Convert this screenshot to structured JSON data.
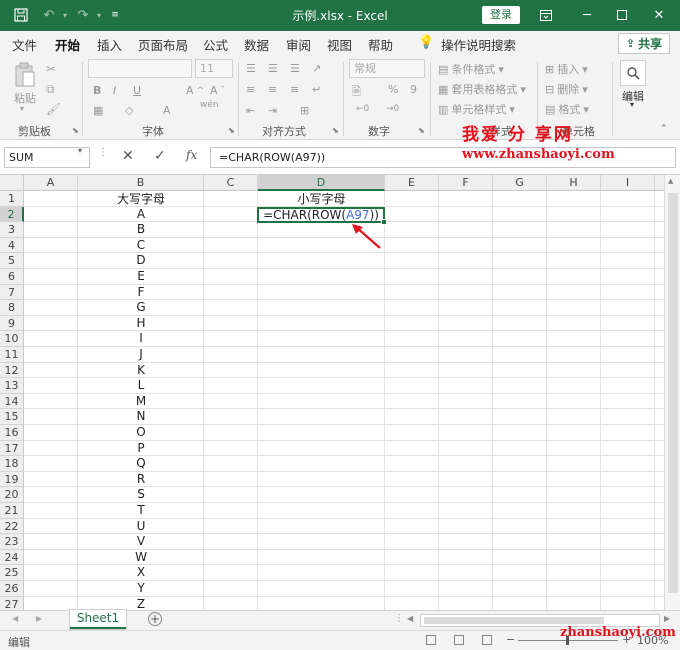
{
  "title_bar": {
    "title": "示例.xlsx  -  Excel",
    "login_label": "登录"
  },
  "tabs": [
    "文件",
    "开始",
    "插入",
    "页面布局",
    "公式",
    "数据",
    "审阅",
    "视图",
    "帮助"
  ],
  "active_tab": "开始",
  "tell_me": "操作说明搜索",
  "share_label": "共享",
  "ribbon": {
    "clipboard": {
      "paste": "粘贴",
      "label": "剪贴板"
    },
    "font": {
      "size": "11",
      "label": "字体",
      "wen": "wén",
      "bold": "B",
      "italic": "I",
      "underline": "U"
    },
    "alignment": {
      "label": "对齐方式"
    },
    "number": {
      "format": "常规",
      "label": "数字",
      "percent": "%",
      "comma": "9"
    },
    "styles": {
      "conditional": "条件格式",
      "table": "套用表格格式",
      "cell": "单元格样式",
      "label_partial": "样式"
    },
    "cells": {
      "insert": "插入",
      "delete": "删除",
      "format": "格式",
      "label_partial": "单元格"
    },
    "editing": {
      "label": "编辑"
    }
  },
  "watermark": {
    "site_cn": "我爱 分 享网",
    "site_url": "www.zhanshaoyi.com",
    "bottom_url": "zhanshaoyi.com"
  },
  "formula_bar": {
    "name_box": "SUM",
    "fx_symbol": "fx",
    "formula": "=CHAR(ROW(A97))"
  },
  "columns": [
    "A",
    "B",
    "C",
    "D",
    "E",
    "F",
    "G",
    "H",
    "I"
  ],
  "selected_column": "D",
  "rows": [
    "1",
    "2",
    "3",
    "4",
    "5",
    "6",
    "7",
    "8",
    "9",
    "10",
    "11",
    "12",
    "13",
    "14",
    "15",
    "16",
    "17",
    "18",
    "19",
    "20",
    "21",
    "22",
    "23",
    "24",
    "25",
    "26",
    "27"
  ],
  "selected_row": "2",
  "cells": {
    "B1": "大写字母",
    "D1": "小写字母",
    "B_letters": [
      "A",
      "B",
      "C",
      "D",
      "E",
      "F",
      "G",
      "H",
      "I",
      "J",
      "K",
      "L",
      "M",
      "N",
      "O",
      "P",
      "Q",
      "R",
      "S",
      "T",
      "U",
      "V",
      "W",
      "X",
      "Y",
      "Z"
    ]
  },
  "active_cell": {
    "prefix": "=CHAR(ROW(",
    "ref": "A97",
    "suffix": "))"
  },
  "sheet_tabs": [
    "Sheet1"
  ],
  "status_bar": {
    "mode": "编辑",
    "zoom": "100%"
  },
  "colors": {
    "excel_green": "#217346",
    "watermark_red": "#e0141f",
    "ref_blue": "#3b6fd6"
  }
}
